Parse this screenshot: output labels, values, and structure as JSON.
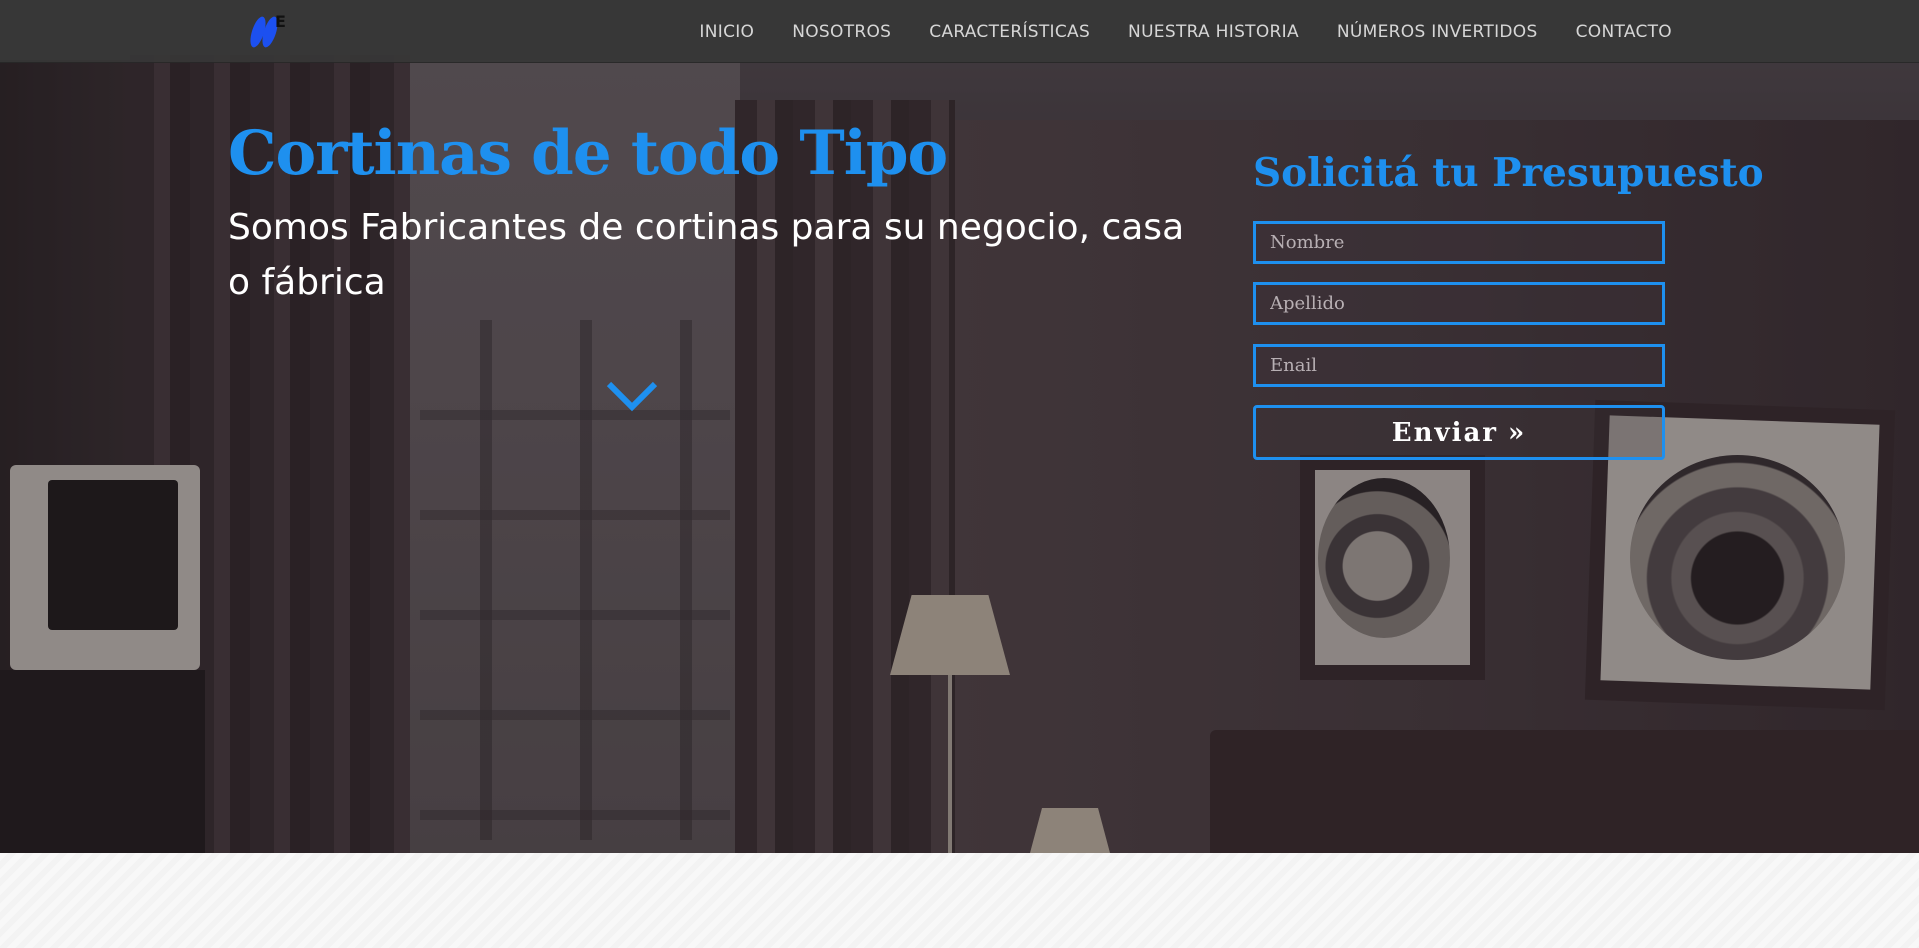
{
  "brand": {
    "logo_letter": "E",
    "accent_color": "#1e90ef",
    "logo_color": "#1c50f0"
  },
  "nav": {
    "items": [
      {
        "label": "INICIO"
      },
      {
        "label": "NOSOTROS"
      },
      {
        "label": "CARACTERÍSTICAS"
      },
      {
        "label": "NUESTRA HISTORIA"
      },
      {
        "label": "NÚMEROS INVERTIDOS"
      },
      {
        "label": "CONTACTO"
      }
    ]
  },
  "hero": {
    "title": "Cortinas de todo Tipo",
    "subtitle": "Somos Fabricantes de cortinas para su negocio, casa o fábrica",
    "scroll_icon": "chevron-down-icon"
  },
  "quote_form": {
    "title": "Solicitá tu Presupuesto",
    "fields": {
      "first_name_placeholder": "Nombre",
      "last_name_placeholder": "Apellido",
      "email_placeholder": "Enail"
    },
    "submit_label": "Enviar",
    "submit_icon": "»"
  }
}
